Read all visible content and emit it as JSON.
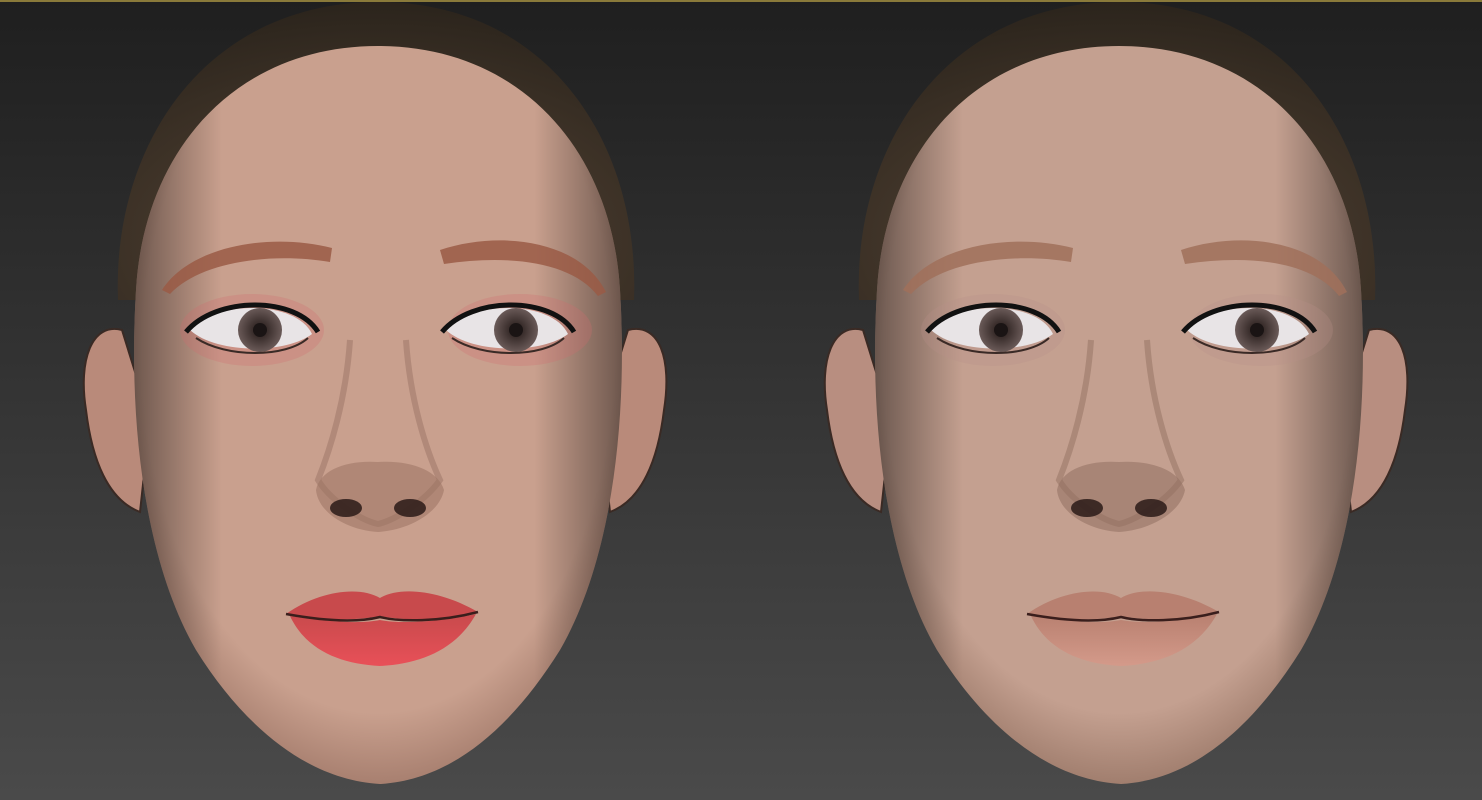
{
  "viewport": {
    "background_top": "#1f1f1f",
    "background_bottom": "#4a4a4a",
    "border_color": "#8a7a3a"
  },
  "faces": [
    {
      "id": "makeup",
      "skin_color": "#c9a08e",
      "skin_shadow": "#9a7263",
      "hair_color": "#2b241c",
      "brow_color": "#9a5a45",
      "lip_color": "#e85058",
      "lip_upper_color": "#c84a4c",
      "eyeshadow_color": "#d06a70",
      "iris_color": "#6a5a58",
      "ear_color": "#b98a7a"
    },
    {
      "id": "natural",
      "skin_color": "#c4a090",
      "skin_shadow": "#927060",
      "hair_color": "#2b241c",
      "brow_color": "#a0705a",
      "lip_color": "#d49a8a",
      "lip_upper_color": "#b88070",
      "eyeshadow_color": "#b8908a",
      "iris_color": "#6a5a58",
      "ear_color": "#b88e80"
    }
  ]
}
